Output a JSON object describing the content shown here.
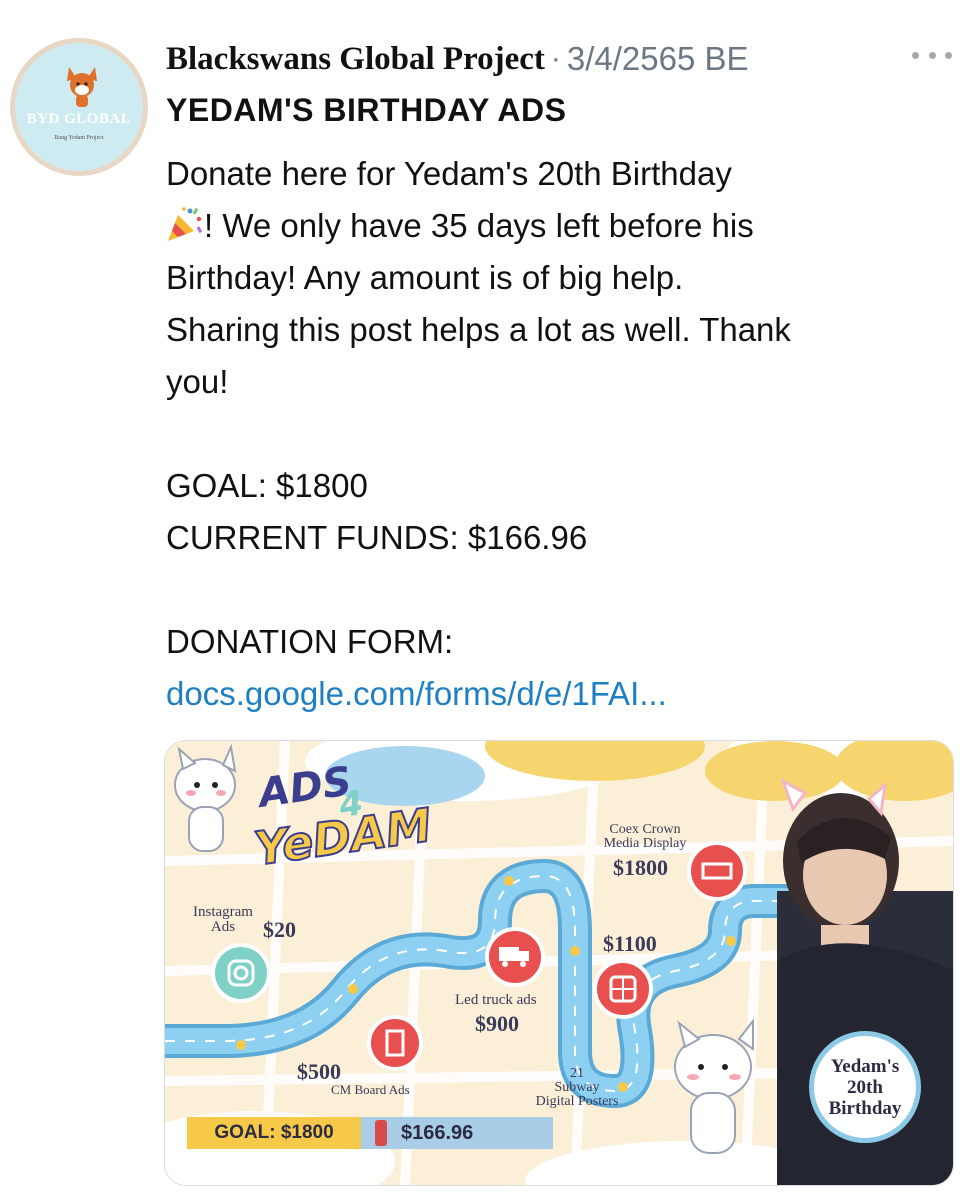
{
  "account": {
    "name": "Blackswans Global Project",
    "separator": "·",
    "date": "3/4/2565 BE",
    "avatar_brand": "BYD GLOBAL",
    "avatar_sub": "Bang Yedam Project"
  },
  "post": {
    "title": "YEDAM'S BIRTHDAY ADS",
    "lines": [
      "Donate here for Yedam's 20th Birthday",
      "! We only have 35 days left before his",
      "Birthday! Any amount is of big help.",
      "Sharing this post helps a lot as well. Thank",
      "you!",
      "",
      "GOAL: $1800",
      "CURRENT FUNDS: $166.96",
      "",
      "DONATION FORM:"
    ],
    "link": "docs.google.com/forms/d/e/1FAI..."
  },
  "image": {
    "logo_top": "ADS",
    "logo_num": "4",
    "logo_bottom": "YeDAM",
    "stops": [
      {
        "label": "Instagram\nAds",
        "price": "$20"
      },
      {
        "label": "CM Board Ads",
        "price": "$500"
      },
      {
        "label": "Led truck ads",
        "price": "$900"
      },
      {
        "label": "21\nSubway\nDigital Posters",
        "price": "$1100"
      },
      {
        "label": "Coex Crown\nMedia Display",
        "price": "$1800"
      }
    ],
    "goal_label": "GOAL: $1800",
    "current": "$166.96",
    "badge_line1": "Yedam's",
    "badge_line2": "20th",
    "badge_line3": "Birthday",
    "progress": 0.0928
  },
  "colors": {
    "link": "#1d7fc4",
    "muted": "#6b7785",
    "road": "#7cc3ea",
    "accent_red": "#d94a4a",
    "accent_yellow": "#f7c948"
  }
}
